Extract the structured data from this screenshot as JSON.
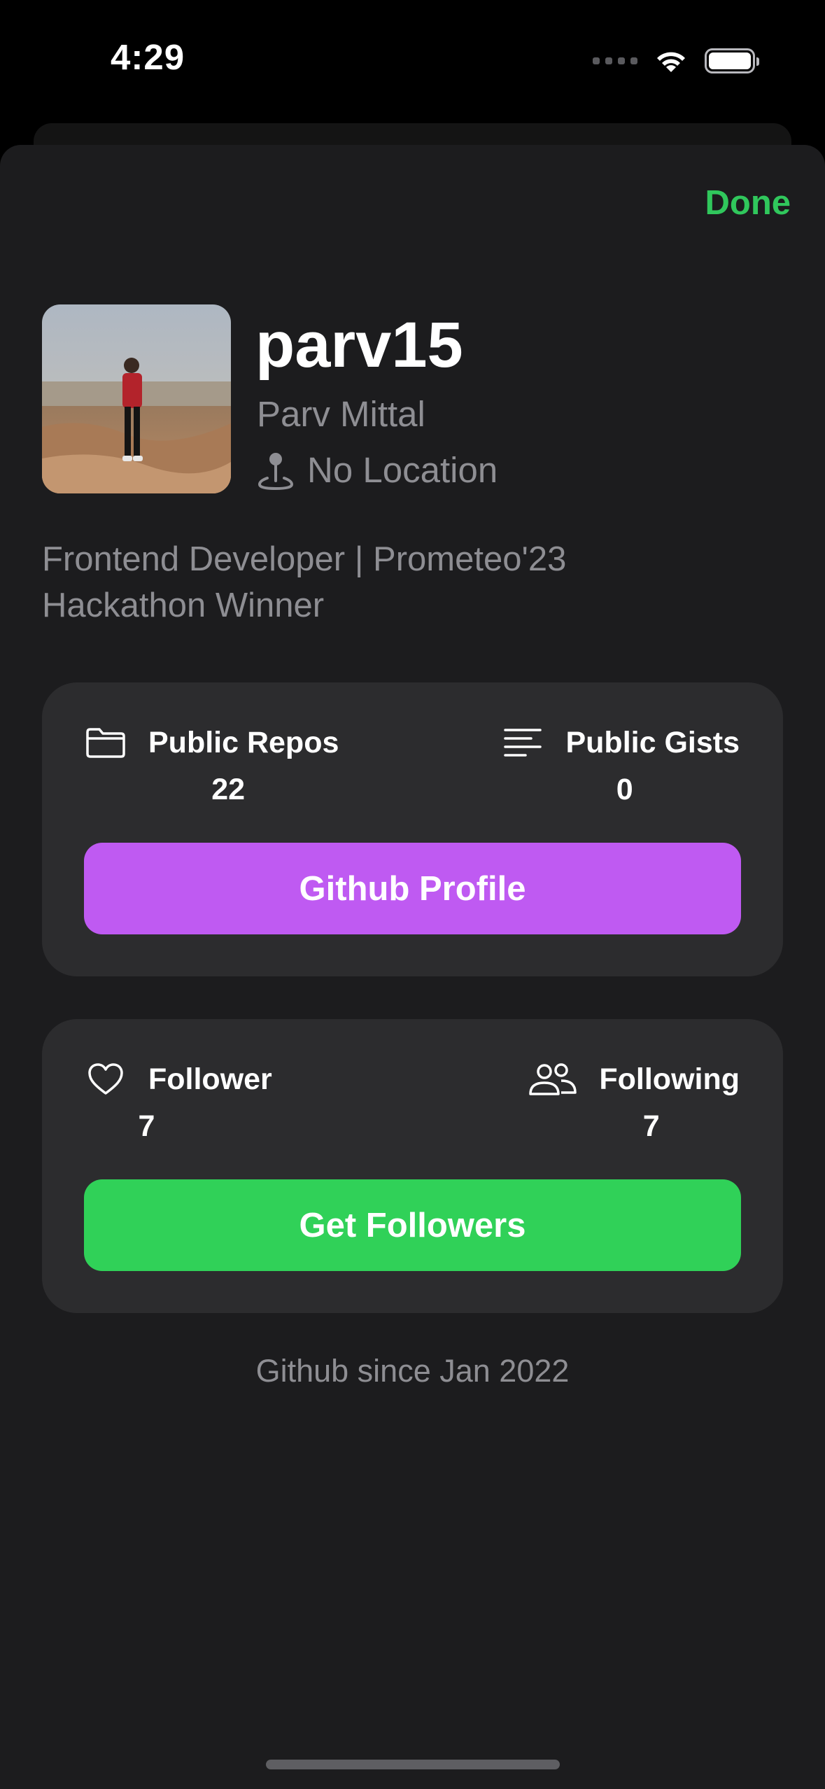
{
  "status_bar": {
    "time": "4:29"
  },
  "header": {
    "done_label": "Done",
    "done_color": "#30c75c"
  },
  "profile": {
    "username": "parv15",
    "name": "Parv Mittal",
    "location": "No Location",
    "bio": "Frontend Developer | Prometeo'23 Hackathon Winner"
  },
  "repos_card": {
    "repos_label": "Public Repos",
    "repos_value": "22",
    "gists_label": "Public Gists",
    "gists_value": "0",
    "button_label": "Github Profile",
    "button_color": "#bf5af2"
  },
  "followers_card": {
    "followers_label": "Follower",
    "followers_value": "7",
    "following_label": "Following",
    "following_value": "7",
    "button_label": "Get Followers",
    "button_color": "#30d158"
  },
  "footer": {
    "since": "Github since Jan 2022"
  },
  "icons": {
    "wifi": "wifi-icon",
    "battery": "battery-icon",
    "location": "location-pin-icon",
    "repos": "folder-icon",
    "gists": "text-align-left-icon",
    "followers": "heart-icon",
    "following": "person-2-icon"
  }
}
